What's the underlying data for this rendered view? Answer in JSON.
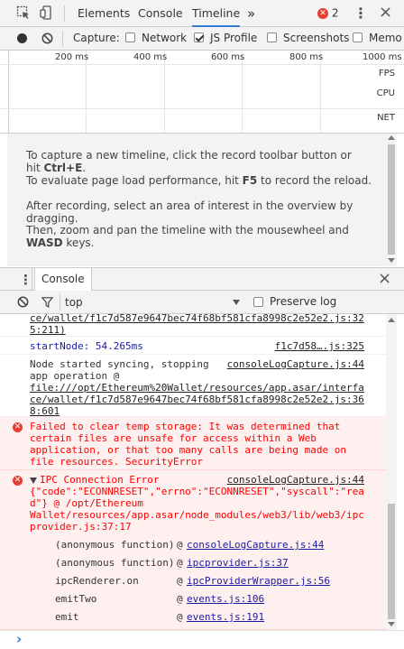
{
  "toolbar": {
    "tabs": [
      "Elements",
      "Console",
      "Timeline"
    ],
    "more_label": "»",
    "error_count": "2",
    "menu_label": "⋮",
    "close_label": "×"
  },
  "timeline_bar": {
    "capture_label": "Capture:",
    "options": [
      {
        "label": "Network",
        "checked": false
      },
      {
        "label": "JS Profile",
        "checked": true
      },
      {
        "label": "Screenshots",
        "checked": false
      },
      {
        "label": "Memo",
        "checked": false
      }
    ]
  },
  "overview": {
    "ticks": [
      "200 ms",
      "400 ms",
      "600 ms",
      "800 ms",
      "1000 ms"
    ],
    "lanes": [
      "FPS",
      "CPU",
      "NET"
    ]
  },
  "help": {
    "p1_prefix": "To capture a new timeline, click the record toolbar button or hit ",
    "p1_key": "Ctrl+E",
    "p1_suffix": ".",
    "p2_prefix": "To evaluate page load performance, hit ",
    "p2_key": "F5",
    "p2_suffix": " to record the reload.",
    "p3": "After recording, select an area of interest in the overview by dragging.",
    "p4_prefix": "Then, zoom and pan the timeline with the mousewheel and ",
    "p4_key": "WASD",
    "p4_suffix": " keys."
  },
  "drawer": {
    "tab_label": "Console",
    "close_label": "×"
  },
  "filter": {
    "context": "top",
    "preserve_log_label": "Preserve log",
    "preserve_log_checked": false
  },
  "console": {
    "m0": {
      "lines": [
        "ce/wallet/f1c7d587e9647bec74f68bf581cfa8998c2e52e2.js:32",
        "5:211)"
      ]
    },
    "m1": {
      "text": "startNode: 54.265ms",
      "source": "f1c7d58….js:325"
    },
    "m2": {
      "lines": [
        "Node started syncing, stopping",
        "app operation @"
      ],
      "link_lines": [
        "file:///opt/Ethereum%20Wallet/resources/app.asar/interfa",
        "ce/wallet/f1c7d587e9647bec74f68bf581cfa8998c2e52e2.js:36",
        "8:601"
      ],
      "source": "consoleLogCapture.js:44"
    },
    "m3": {
      "lines": [
        "Failed to clear temp storage: It was determined that",
        "certain files are unsafe for access within a Web",
        "application, or that too many calls are being made on",
        "file resources. SecurityError"
      ]
    },
    "m4": {
      "title": "IPC Connection Error",
      "source": "consoleLogCapture.js:44",
      "lines": [
        "{\"code\":\"ECONNRESET\",\"errno\":\"ECONNRESET\",\"syscall\":\"rea",
        "d\"} @ /opt/Ethereum",
        "Wallet/resources/app.asar/node_modules/web3/lib/web3/ipc",
        "provider.js:37:17"
      ],
      "stack": [
        {
          "fn": "(anonymous function)",
          "at": "@",
          "file": "consoleLogCapture.js:44"
        },
        {
          "fn": "(anonymous function)",
          "at": "@",
          "file": "ipcprovider.js:37"
        },
        {
          "fn": "ipcRenderer.on",
          "at": "@",
          "file": "ipcProviderWrapper.js:56"
        },
        {
          "fn": "emitTwo",
          "at": "@",
          "file": "events.js:106"
        },
        {
          "fn": "emit",
          "at": "@",
          "file": "events.js:191"
        }
      ]
    }
  },
  "prompt": {
    "symbol": "›"
  },
  "colors": {
    "accent": "#3879d9",
    "error_text": "#ff0000",
    "error_bg": "#fff0f0",
    "link_blue": "#1a1aa6"
  }
}
